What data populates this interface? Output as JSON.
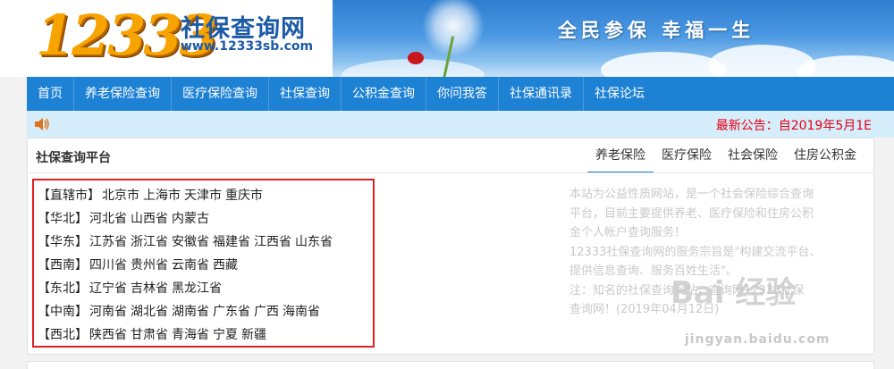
{
  "header": {
    "logo_number": "12333",
    "logo_title": "社保查询网",
    "logo_url": "www.12333sb.com",
    "slogan": "全民参保  幸福一生"
  },
  "nav": {
    "items": [
      "首页",
      "养老保险查询",
      "医疗保险查询",
      "社保查询",
      "公积金查询",
      "你问我答",
      "社保通讯录",
      "社保论坛"
    ]
  },
  "notice": {
    "icon": "speaker-icon",
    "text": "最新公告：自2019年5月1E"
  },
  "panel": {
    "title": "社保查询平台",
    "tabs": [
      "养老保险",
      "医疗保险",
      "社会保险",
      "住房公积金"
    ],
    "active_tab": "养老保险",
    "regions": [
      {
        "name": "【直辖市】",
        "cities": [
          "北京市",
          "上海市",
          "天津市",
          "重庆市"
        ]
      },
      {
        "name": "【华北】",
        "cities": [
          "河北省",
          "山西省",
          "内蒙古"
        ]
      },
      {
        "name": "【华东】",
        "cities": [
          "江苏省",
          "浙江省",
          "安徽省",
          "福建省",
          "江西省",
          "山东省"
        ]
      },
      {
        "name": "【西南】",
        "cities": [
          "四川省",
          "贵州省",
          "云南省",
          "西藏"
        ]
      },
      {
        "name": "【东北】",
        "cities": [
          "辽宁省",
          "吉林省",
          "黑龙江省"
        ]
      },
      {
        "name": "【中南】",
        "cities": [
          "河南省",
          "湖北省",
          "湖南省",
          "广东省",
          "广西",
          "海南省"
        ]
      },
      {
        "name": "【西北】",
        "cities": [
          "陕西省",
          "甘肃省",
          "青海省",
          "宁夏",
          "新疆"
        ]
      }
    ],
    "intro_lines": [
      "本站为公益性质网站，是一个社会保险综合查询",
      "平台，目前主要提供养老、医疗保险和住房公积",
      "金个人帐户查询服务！",
      "12333社保查询网的服务宗旨是\"构建交流平台、",
      "提供信息查询、服务百姓生活\"。",
      "注：知名的社保查询网站，查询网12333社保",
      "查询网！(2019年04月12日)"
    ]
  },
  "watermark": {
    "main": "Bai 经验",
    "sub": "jingyan.baidu.com"
  }
}
